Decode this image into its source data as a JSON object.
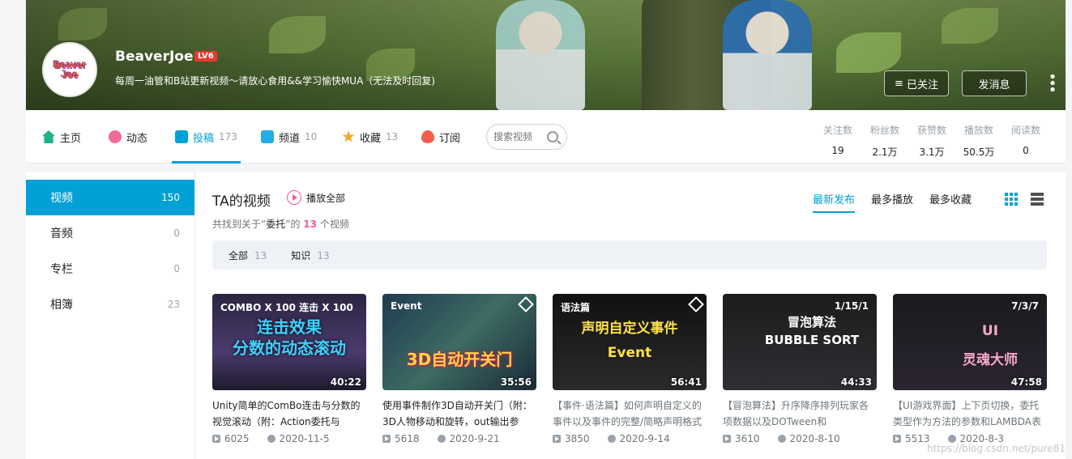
{
  "profile": {
    "name": "BeaverJoe",
    "level": "LV6",
    "avatar_text": "Beaver\nJoe",
    "sign": "每周一油管和B站更新视频～请放心食用&&学习愉快MUA（无法及时回复)",
    "follow_btn": "已关注",
    "message_btn": "发消息",
    "more_btn": "⋮"
  },
  "nav": {
    "home": "主页",
    "dynamic": "动态",
    "upload": "投稿",
    "upload_count": "173",
    "channel": "频道",
    "channel_count": "10",
    "favorite": "收藏",
    "favorite_count": "13",
    "subscribe": "订阅",
    "search_placeholder": "搜索视频"
  },
  "stats": [
    {
      "label": "关注数",
      "value": "19"
    },
    {
      "label": "粉丝数",
      "value": "2.1万"
    },
    {
      "label": "获赞数",
      "value": "3.1万"
    },
    {
      "label": "播放数",
      "value": "50.5万"
    },
    {
      "label": "阅读数",
      "value": "0"
    }
  ],
  "sidebar": [
    {
      "label": "视频",
      "count": "150"
    },
    {
      "label": "音频",
      "count": "0"
    },
    {
      "label": "专栏",
      "count": "0"
    },
    {
      "label": "相簿",
      "count": "23"
    }
  ],
  "main": {
    "title": "TA的视频",
    "play_all": "播放全部",
    "found_prefix": "共找到关于“",
    "found_keyword": "委托",
    "found_mid": "”的",
    "found_count": "13",
    "found_suffix": "个视频",
    "orders": [
      "最新发布",
      "最多播放",
      "最多收藏"
    ],
    "filters": [
      {
        "label": "全部",
        "count": "13"
      },
      {
        "label": "知识",
        "count": "13"
      }
    ]
  },
  "videos": [
    {
      "thumb_text": "连击效果\n分数的动态滚动",
      "thumb_top": "COMBO X 100  连击 X 100",
      "duration": "40:22",
      "title": "Unity简单的ComBo连击与分数的视觉滚动（附：Action委托与",
      "views": "6025",
      "date": "2020-11-5"
    },
    {
      "thumb_text": "3D自动开关门",
      "thumb_top": "Event",
      "duration": "35:56",
      "title": "使用事件制作3D自动开关门（附：3D人物移动和旋转，out输出参",
      "views": "5618",
      "date": "2020-9-21"
    },
    {
      "thumb_text": "声明自定义事件\nEvent",
      "thumb_top": "语法篇",
      "duration": "56:41",
      "title": "【事件·语法篇】如何声明自定义的事件以及事件的完整/简略声明格式",
      "views": "3850",
      "date": "2020-9-14"
    },
    {
      "thumb_text": "冒泡算法\nBUBBLE SORT",
      "thumb_top": "1/15/1",
      "duration": "44:33",
      "title": "【冒泡算法】升序降序排列玩家各项数据以及DOTween和",
      "views": "3610",
      "date": "2020-8-10"
    },
    {
      "thumb_text": "UI\n灵魂大师",
      "thumb_top": "7/3/7",
      "duration": "47:58",
      "title": "【UI游戏界面】上下页切换，委托类型作为方法的参数和LAMBDA表",
      "views": "5513",
      "date": "2020-8-3"
    }
  ],
  "watermark": "https://blog.csdn.net/pure81",
  "colors": {
    "accent": "#00a1d6",
    "pink": "#f25d8e",
    "level": "#e8382e"
  }
}
